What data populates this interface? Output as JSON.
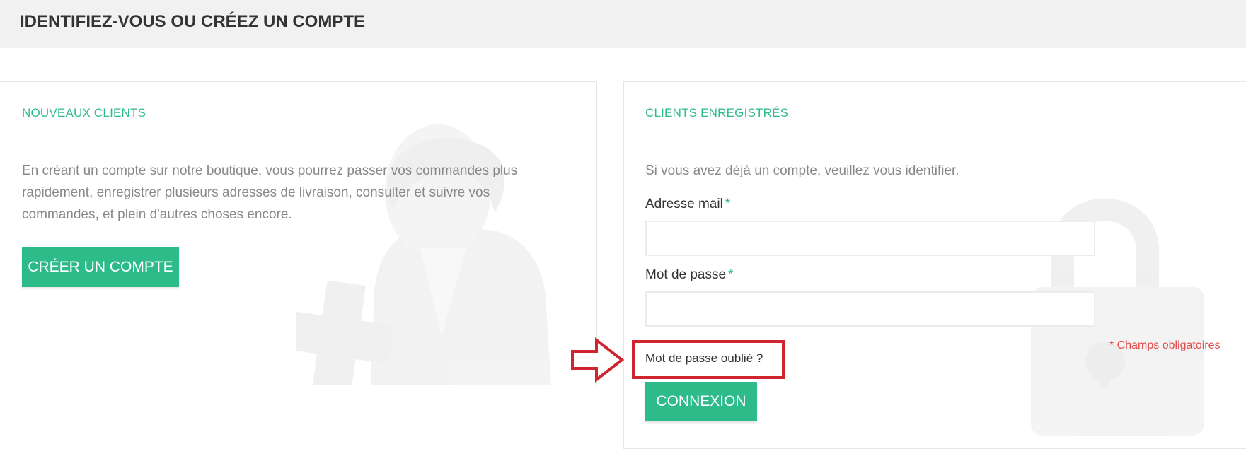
{
  "page": {
    "title": "IDENTIFIEZ-VOUS OU CRÉEZ UN COMPTE"
  },
  "new_customers": {
    "heading": "NOUVEAUX CLIENTS",
    "description": "En créant un compte sur notre boutique, vous pourrez passer vos commandes plus rapidement, enregistrer plusieurs adresses de livraison, consulter et suivre vos commandes, et plein d'autres choses encore.",
    "create_button": "CRÉER UN COMPTE"
  },
  "registered_customers": {
    "heading": "CLIENTS ENREGISTRÉS",
    "intro": "Si vous avez déjà un compte, veuillez vous identifier.",
    "email_label": "Adresse mail",
    "password_label": "Mot de passe",
    "required_marker": "*",
    "email_value": "",
    "password_value": "",
    "required_note": "* Champs obligatoires",
    "forgot_password": "Mot de passe oublié ?",
    "login_button": "CONNEXION"
  },
  "colors": {
    "accent": "#2dbb8a",
    "header_bg": "#f1f1f1",
    "annotation": "#d0242f",
    "required_note": "#e24a4a"
  },
  "icons": {
    "new_customer_watermark": "user-add-icon",
    "registered_watermark": "padlock-icon",
    "annotation_arrow": "arrow-right-icon"
  }
}
